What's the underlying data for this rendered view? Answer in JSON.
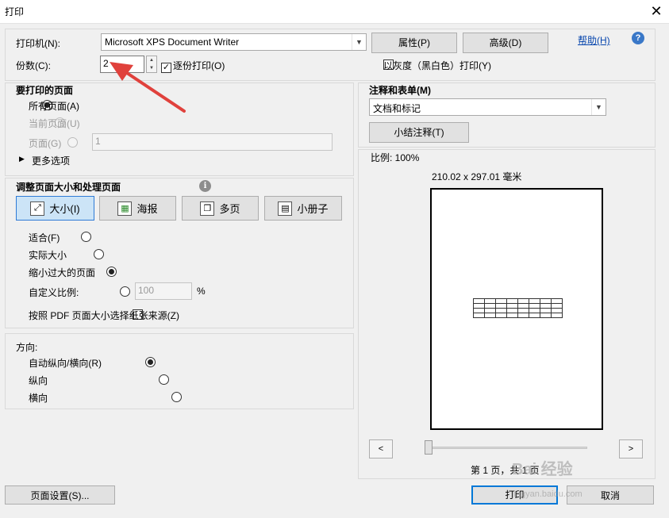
{
  "window": {
    "title": "打印",
    "close_glyph": "✕"
  },
  "printer": {
    "label": "打印机(N):",
    "selected": "Microsoft XPS Document Writer",
    "properties_btn": "属性(P)",
    "advanced_btn": "高级(D)",
    "help_link": "帮助(H)",
    "help_icon": "?"
  },
  "copies": {
    "label": "份数(C):",
    "value": "2",
    "collate_label": "逐份打印(O)",
    "collate_checked": true,
    "grayscale_label": "以灰度（黑白色）打印(Y)",
    "grayscale_checked": false
  },
  "pages_to_print": {
    "title": "要打印的页面",
    "all_label": "所有页面(A)",
    "current_label": "当前页面(U)",
    "pages_label": "页面(G)",
    "pages_value": "1",
    "more_options": "更多选项",
    "more_options_glyph": "▶",
    "selected": "all"
  },
  "page_sizing": {
    "title": "调整页面大小和处理页面",
    "info_glyph": "i",
    "buttons": [
      {
        "label": "大小(I)",
        "icon": "size-icon",
        "glyph": "⤢",
        "active": true
      },
      {
        "label": "海报",
        "icon": "poster-icon",
        "glyph": "▦",
        "active": false
      },
      {
        "label": "多页",
        "icon": "multiple-pages-icon",
        "glyph": "❐",
        "active": false
      },
      {
        "label": "小册子",
        "icon": "booklet-icon",
        "glyph": "▤",
        "active": false
      }
    ],
    "fit_label": "适合(F)",
    "actual_label": "实际大小",
    "shrink_label": "缩小过大的页面",
    "custom_label": "自定义比例:",
    "custom_value": "100",
    "percent": "%",
    "selected": "shrink",
    "paper_source_label": "按照 PDF 页面大小选择纸张来源(Z)",
    "paper_source_checked": false
  },
  "orientation": {
    "title": "方向:",
    "auto_label": "自动纵向/横向(R)",
    "portrait_label": "纵向",
    "landscape_label": "横向",
    "selected": "auto"
  },
  "comments_forms": {
    "title": "注释和表单(M)",
    "selected": "文档和标记",
    "summarize_btn": "小结注释(T)"
  },
  "preview": {
    "scale_label": "比例: 100%",
    "dimensions": "210.02 x 297.01 毫米",
    "prev_glyph": "<",
    "next_glyph": ">",
    "page_info": "第 1 页，共 1 页"
  },
  "footer": {
    "page_setup_btn": "页面设置(S)...",
    "print_btn": "打印",
    "cancel_btn": "取消"
  },
  "annotation": {
    "arrow_color": "#e0413c"
  },
  "watermark": {
    "text": "Bai 经验",
    "sub": "jingyan.baidu.com"
  }
}
